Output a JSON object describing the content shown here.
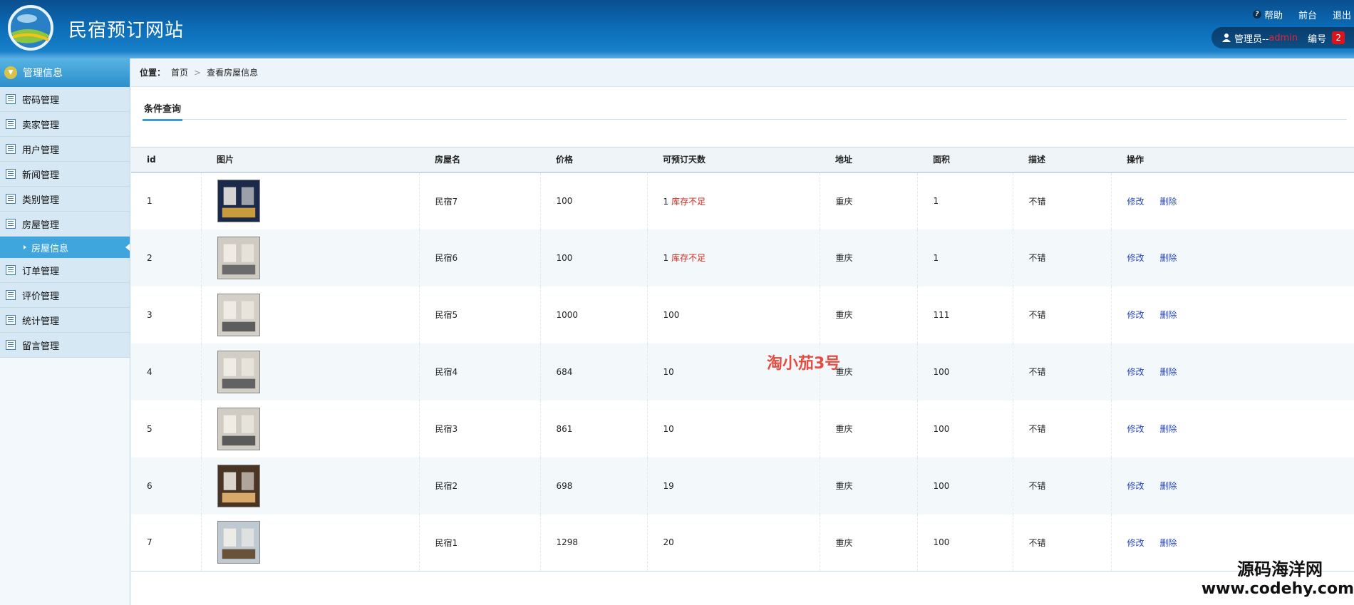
{
  "header": {
    "site_title": "民宿预订网站",
    "help_label": "帮助",
    "front_label": "前台",
    "logout_label": "退出",
    "user_prefix": "管理员--",
    "user_name": "admin",
    "id_label": "编号",
    "id_value": "2"
  },
  "sidebar": {
    "title": "管理信息",
    "items": [
      {
        "label": "密码管理"
      },
      {
        "label": "卖家管理"
      },
      {
        "label": "用户管理"
      },
      {
        "label": "新闻管理"
      },
      {
        "label": "类别管理"
      },
      {
        "label": "房屋管理"
      }
    ],
    "active_sub": "房屋信息",
    "items_after": [
      {
        "label": "订单管理"
      },
      {
        "label": "评价管理"
      },
      {
        "label": "统计管理"
      },
      {
        "label": "留言管理"
      }
    ]
  },
  "breadcrumb": {
    "label": "位置：",
    "home": "首页",
    "current": "查看房屋信息"
  },
  "filter": {
    "tab_label": "条件查询"
  },
  "table": {
    "headers": [
      "id",
      "图片",
      "房屋名",
      "价格",
      "可预订天数",
      "地址",
      "面积",
      "描述",
      "操作"
    ],
    "rows": [
      {
        "id": "1",
        "name": "民宿7",
        "price": "100",
        "days": "1",
        "warn": "库存不足",
        "addr": "重庆",
        "area": "1",
        "desc": "不错"
      },
      {
        "id": "2",
        "name": "民宿6",
        "price": "100",
        "days": "1",
        "warn": "库存不足",
        "addr": "重庆",
        "area": "1",
        "desc": "不错"
      },
      {
        "id": "3",
        "name": "民宿5",
        "price": "1000",
        "days": "100",
        "warn": "",
        "addr": "重庆",
        "area": "111",
        "desc": "不错"
      },
      {
        "id": "4",
        "name": "民宿4",
        "price": "684",
        "days": "10",
        "warn": "",
        "addr": "重庆",
        "area": "100",
        "desc": "不错"
      },
      {
        "id": "5",
        "name": "民宿3",
        "price": "861",
        "days": "10",
        "warn": "",
        "addr": "重庆",
        "area": "100",
        "desc": "不错"
      },
      {
        "id": "6",
        "name": "民宿2",
        "price": "698",
        "days": "19",
        "warn": "",
        "addr": "重庆",
        "area": "100",
        "desc": "不错"
      },
      {
        "id": "7",
        "name": "民宿1",
        "price": "1298",
        "days": "20",
        "warn": "",
        "addr": "重庆",
        "area": "100",
        "desc": "不错"
      }
    ],
    "edit_label": "修改",
    "delete_label": "删除"
  },
  "watermark": "淘小茄3号",
  "brand": {
    "cn": "源码海洋网",
    "url": "www.codehy.com"
  }
}
